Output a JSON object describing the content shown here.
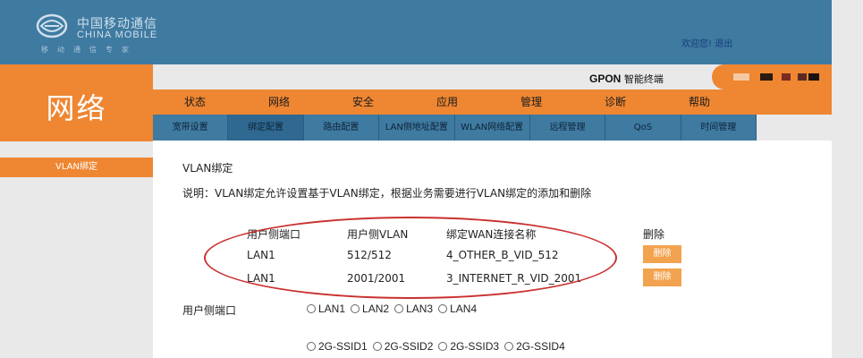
{
  "header": {
    "logo_cn": "中国移动通信",
    "logo_en": "CHINA MOBILE",
    "logo_sub": "移动通信专家",
    "welcome": "欢迎您!",
    "logout": "退出"
  },
  "brand": {
    "title": "网络"
  },
  "gpon": {
    "title_bold": "GPON",
    "title_rest": " 智能终端"
  },
  "main_nav": [
    "状态",
    "网络",
    "安全",
    "应用",
    "管理",
    "诊断",
    "帮助"
  ],
  "sub_nav": [
    "宽带设置",
    "绑定配置",
    "路由配置",
    "LAN侧地址配置",
    "WLAN网络配置",
    "远程管理",
    "QoS",
    "时间管理"
  ],
  "sidebar": {
    "active_item": "VLAN绑定"
  },
  "content": {
    "title": "VLAN绑定",
    "description": "说明：VLAN绑定允许设置基于VLAN绑定，根据业务需要进行VLAN绑定的添加和删除"
  },
  "table": {
    "headers": [
      "用户侧端口",
      "用户侧VLAN",
      "绑定WAN连接名称",
      "删除"
    ],
    "rows": [
      {
        "port": "LAN1",
        "vlan": "512/512",
        "wan": "4_OTHER_B_VID_512",
        "delete": "删除"
      },
      {
        "port": "LAN1",
        "vlan": "2001/2001",
        "wan": "3_INTERNET_R_VID_2001",
        "delete": "删除"
      }
    ]
  },
  "port_select": {
    "label": "用户侧端口",
    "lan_options": [
      "LAN1",
      "LAN2",
      "LAN3",
      "LAN4"
    ],
    "ssid_options": [
      "2G-SSID1",
      "2G-SSID2",
      "2G-SSID3",
      "2G-SSID4"
    ]
  },
  "colors": {
    "header_blue": "#3f7aa1",
    "accent_orange": "#ee8632",
    "annotation_red": "#c9312f"
  }
}
